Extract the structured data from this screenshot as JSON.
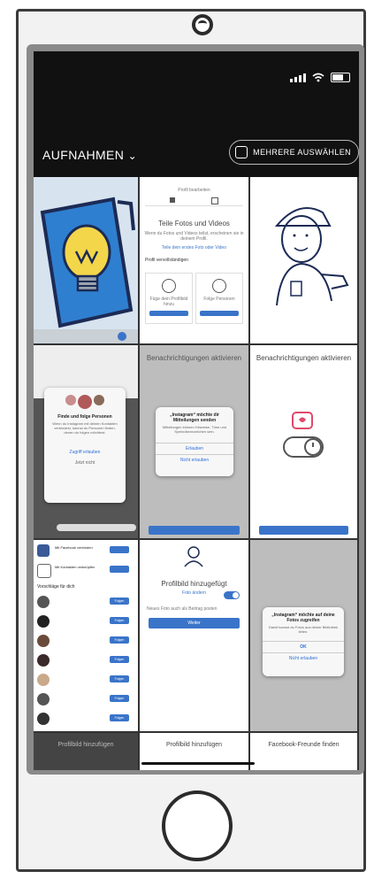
{
  "status_bar": {
    "signal": "signal-icon",
    "wifi": "wifi-icon",
    "battery": "battery-icon"
  },
  "header": {
    "album_label": "AUFNAHMEN",
    "album_chevron": "chevron-down-icon",
    "multi_select_label": "MEHRERE AUSWÄHLEN"
  },
  "tiles": {
    "t2": {
      "top_title": "Profil bearbeiten",
      "heading": "Teile Fotos und Videos",
      "s1": "Profil vervollständigen",
      "b1": "Füge dein Profilbild hinzu",
      "b2": "Folge Personen"
    },
    "t4": {
      "title": "Finde und folge Personen",
      "body": "Wenn du Instagram mit deinen Kontakten verbindest, kannst du Personen finden, denen du folgen möchtest.",
      "button": "Zugriff erlauben",
      "link": "Jetzt nicht"
    },
    "t5": {
      "title": "Benachrichtigungen aktivieren",
      "dialog_title": "„Instagram“ möchte dir Mitteilungen senden",
      "dialog_body": "Mitteilungen können Hinweise, Töne und Symbolkennzeichen sein.",
      "dialog_btn1": "Erlauben",
      "dialog_btn2": "Nicht erlauben"
    },
    "t6": {
      "title": "Benachrichtigungen aktivieren"
    },
    "t7": {
      "r1": "Mit Facebook verbinden",
      "r2": "Mit Kontakten verknüpfen",
      "suggest": "Vorschläge für dich",
      "follow_btn": "Folgen"
    },
    "t8": {
      "heading": "Profilbild hinzugefügt",
      "edit": "Foto ändern",
      "toggle_label": "Neues Foto auch als Beitrag posten",
      "button": "Weiter"
    },
    "t9": {
      "dialog_title": "„Instagram“ möchte auf deine Fotos zugreifen",
      "dialog_body": "Damit kannst du Fotos aus deiner Bibliothek teilen.",
      "dialog_btn1": "OK",
      "dialog_btn2": "Nicht erlauben"
    }
  },
  "captions": {
    "c1": "Profilbild hinzufügen",
    "c2": "Profilbild hinzufügen",
    "c3": "Facebook-Freunde finden"
  },
  "colors": {
    "accent_blue": "#3a74c9",
    "toggle_blue": "#3a74c9",
    "bulb_yellow": "#f4d64a",
    "bulb_bg": "#2f7fd0"
  }
}
